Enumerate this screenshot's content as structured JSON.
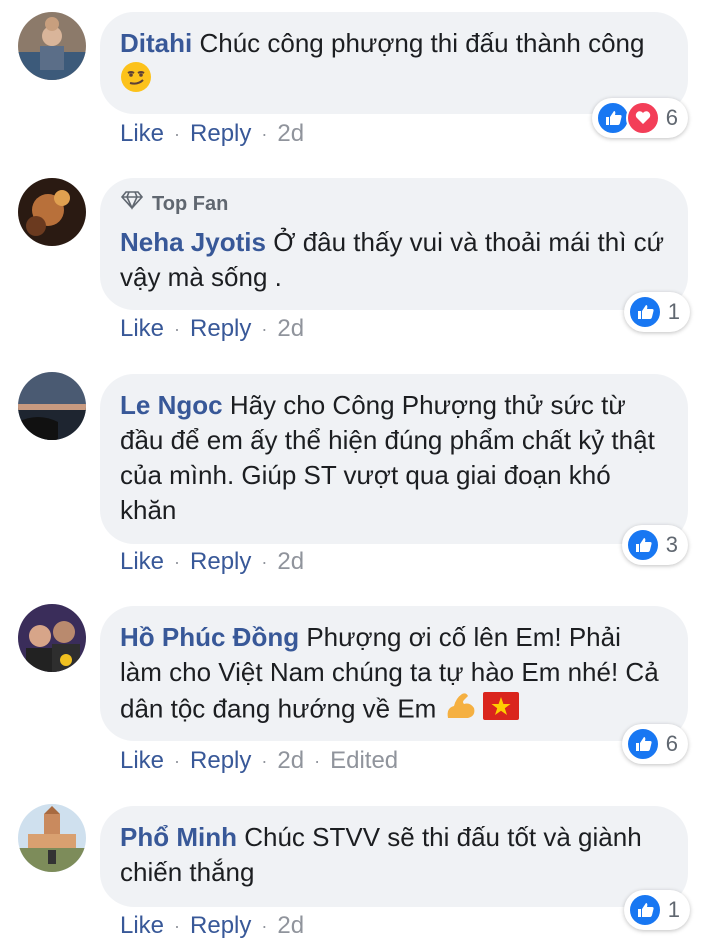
{
  "comments": [
    {
      "author": "Ditahi",
      "text": "Chúc công phượng thi đấu thành công",
      "emoji": "smirk-face",
      "actions": {
        "like": "Like",
        "reply": "Reply",
        "time": "2d"
      },
      "reactions": {
        "types": [
          "like",
          "love"
        ],
        "count": "6"
      }
    },
    {
      "badge": "Top Fan",
      "author": "Neha Jyotis",
      "text": "Ở đâu thấy vui và thoải mái thì cứ vậy mà sống .",
      "actions": {
        "like": "Like",
        "reply": "Reply",
        "time": "2d"
      },
      "reactions": {
        "types": [
          "like"
        ],
        "count": "1"
      }
    },
    {
      "author": "Le Ngoc",
      "text": "Hãy cho Công Phượng thử sức từ đầu để em ấy thể hiện đúng phẩm chất kỷ thật của mình. Giúp ST vượt qua giai đoạn khó khăn",
      "actions": {
        "like": "Like",
        "reply": "Reply",
        "time": "2d"
      },
      "reactions": {
        "types": [
          "like"
        ],
        "count": "3"
      }
    },
    {
      "author": "Hồ Phúc Đồng",
      "text": "Phượng ơi cố lên Em! Phải làm cho Việt Nam chúng ta tự hào Em nhé! Cả dân tộc đang hướng về Em",
      "emoji": "flexed-biceps, vietnam-flag",
      "actions": {
        "like": "Like",
        "reply": "Reply",
        "time": "2d",
        "edited": "Edited"
      },
      "reactions": {
        "types": [
          "like"
        ],
        "count": "6"
      }
    },
    {
      "author": "Phổ Minh",
      "text": "Chúc STVV sẽ thi đấu tốt và giành chiến thắng",
      "actions": {
        "like": "Like",
        "reply": "Reply",
        "time": "2d"
      },
      "reactions": {
        "types": [
          "like"
        ],
        "count": "1"
      }
    }
  ],
  "colors": {
    "link": "#385898",
    "bubble": "#f0f2f5",
    "like": "#1877f2",
    "love": "#f33e58"
  }
}
